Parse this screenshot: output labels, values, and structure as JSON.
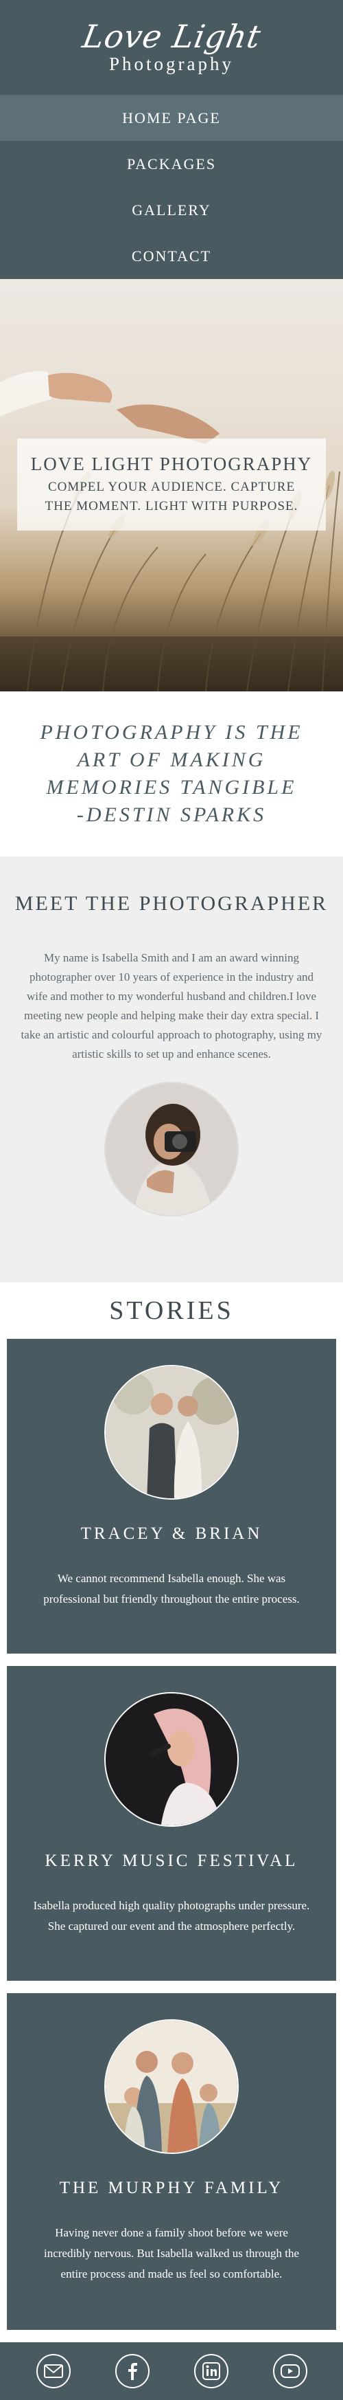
{
  "brand": {
    "script": "Love Light",
    "sub": "Photography"
  },
  "nav": [
    {
      "label": "HOME PAGE",
      "active": true
    },
    {
      "label": "PACKAGES",
      "active": false
    },
    {
      "label": "GALLERY",
      "active": false
    },
    {
      "label": "CONTACT",
      "active": false
    }
  ],
  "hero": {
    "title": "LOVE LIGHT PHOTOGRAPHY",
    "tagline_1": "COMPEL YOUR AUDIENCE. CAPTURE",
    "tagline_2": "THE MOMENT. LIGHT WITH PURPOSE."
  },
  "quote": {
    "line_1": "PHOTOGRAPHY IS THE",
    "line_2": "ART OF MAKING",
    "line_3": "MEMORIES TANGIBLE",
    "line_4": "-DESTIN SPARKS"
  },
  "meet": {
    "heading": "MEET THE PHOTOGRAPHER",
    "body": "My name is Isabella Smith and I am an award winning photographer over 10 years of experience in the industry and wife and mother to my wonderful husband and children.I love meeting new people and helping make their day extra special. I take an artistic and colourful approach to photography, using my artistic skills to set up and enhance scenes."
  },
  "stories": {
    "heading": "STORIES",
    "items": [
      {
        "title": "TRACEY & BRIAN",
        "text": "We cannot recommend Isabella enough. She was professional but friendly throughout the entire process."
      },
      {
        "title": "KERRY MUSIC FESTIVAL",
        "text": "Isabella produced high quality photographs under pressure. She captured our event and the atmosphere perfectly."
      },
      {
        "title": "THE MURPHY FAMILY",
        "text": "Having never done a family shoot before we were incredibly nervous. But Isabella walked us through the entire process and made us feel so comfortable."
      }
    ]
  },
  "footer": {
    "icons": [
      "email-icon",
      "facebook-icon",
      "linkedin-icon",
      "youtube-icon"
    ]
  },
  "colors": {
    "primary": "#4a5a61",
    "active_nav": "#5d7078",
    "light_bg": "#efefef"
  }
}
